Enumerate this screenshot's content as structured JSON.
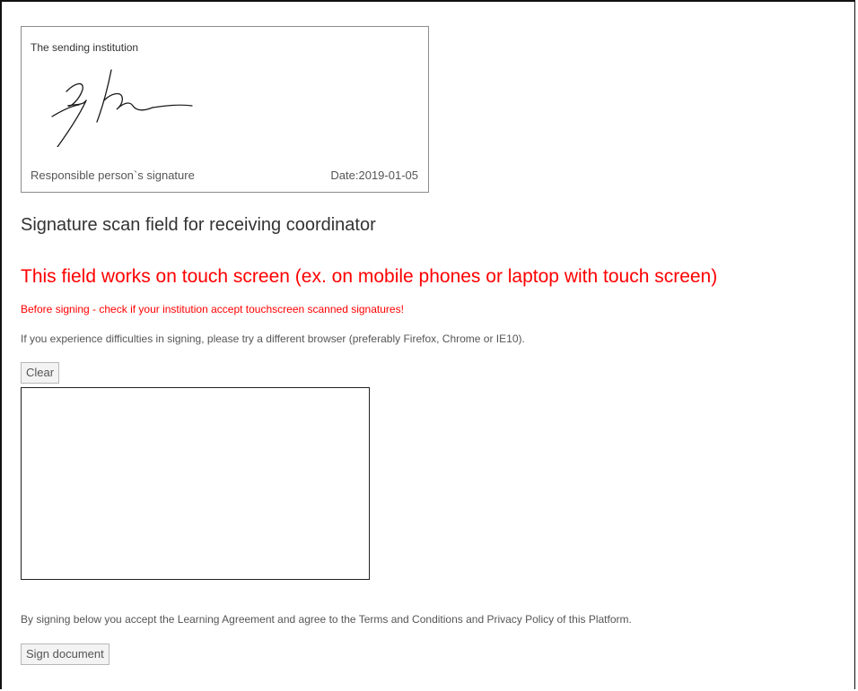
{
  "sending_box": {
    "title": "The sending institution",
    "signature_label": "Responsible person`s signature",
    "date_label": "Date:2019-01-05"
  },
  "heading": "Signature scan field for receiving coordinator",
  "touch_warning": "This field works on touch screen (ex. on mobile phones or laptop with touch screen)",
  "check_warning": "Before signing - check if your institution accept touchscreen scanned signatures!",
  "browser_note": "If you experience difficulties in signing, please try a different browser (preferably Firefox, Chrome or IE10).",
  "clear_label": "Clear",
  "accept_note": "By signing below you accept the Learning Agreement and agree to the Terms and Conditions and Privacy Policy of this Platform.",
  "sign_label": "Sign document",
  "colors": {
    "warning": "#ff0000",
    "text": "#555555",
    "heading": "#333333"
  }
}
